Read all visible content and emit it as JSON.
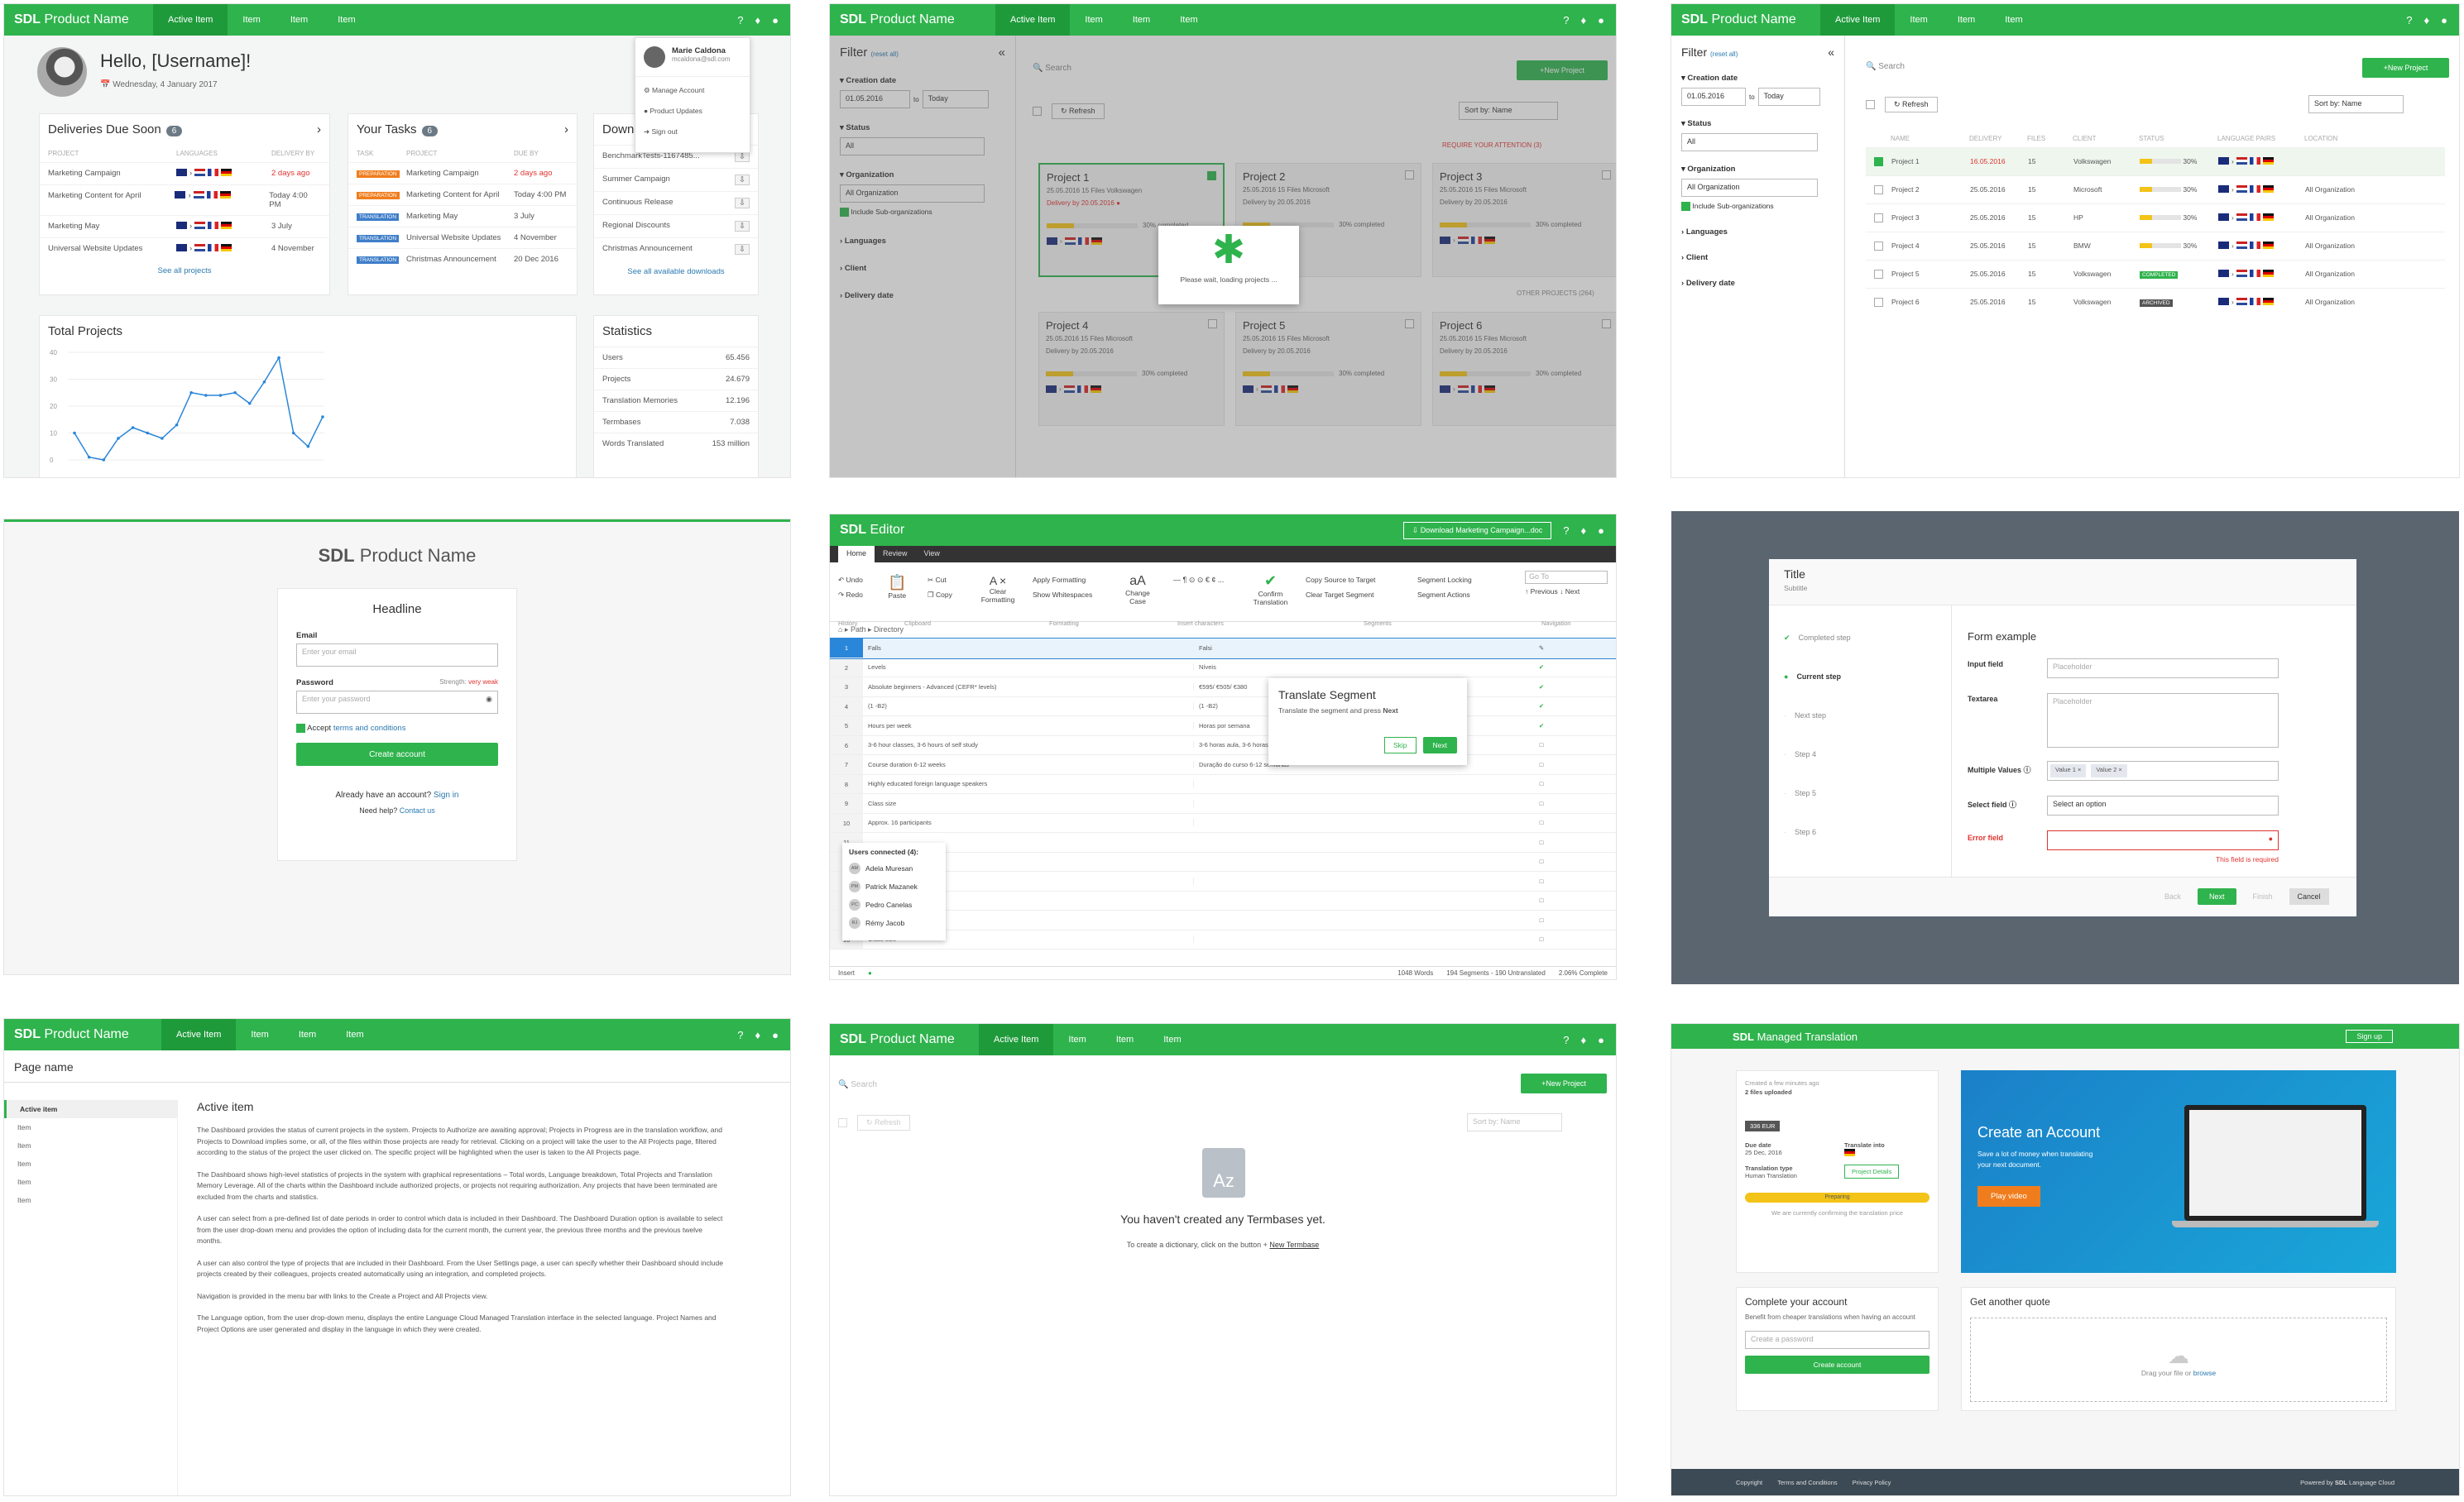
{
  "common": {
    "logo_brand": "SDL",
    "logo_product": "Product Name",
    "nav": [
      "Active Item",
      "Item",
      "Item",
      "Item"
    ],
    "icons": [
      "help-icon",
      "bell-icon",
      "user-icon"
    ]
  },
  "dashboard": {
    "greeting": "Hello, [Username]!",
    "date": "Wednesday, 4 January 2017",
    "user_menu": {
      "name": "Marie Caldona",
      "email": "mcaldona@sdl.com",
      "items": [
        "Manage Account",
        "Product Updates",
        "Sign out"
      ]
    },
    "deliveries": {
      "title": "Deliveries Due Soon",
      "count": "6",
      "cols": [
        "PROJECT",
        "LANGUAGES",
        "DELIVERY BY"
      ],
      "rows": [
        {
          "project": "Marketing Campaign",
          "due": "2 days ago",
          "late": true
        },
        {
          "project": "Marketing Content for April",
          "due": "Today 4:00 PM",
          "late": false
        },
        {
          "project": "Marketing May",
          "due": "3 July",
          "late": false
        },
        {
          "project": "Universal Website Updates",
          "due": "4 November",
          "late": false
        }
      ],
      "link": "See all projects"
    },
    "tasks": {
      "title": "Your Tasks",
      "count": "6",
      "cols": [
        "TASK",
        "PROJECT",
        "DUE BY"
      ],
      "rows": [
        {
          "tag": "PREPARATION",
          "project": "Marketing Campaign",
          "due": "2 days ago",
          "late": true
        },
        {
          "tag": "PREPARATION",
          "project": "Marketing Content for April",
          "due": "Today 4:00 PM",
          "late": false
        },
        {
          "tag": "TRANSLATION",
          "project": "Marketing May",
          "due": "3 July",
          "late": false
        },
        {
          "tag": "TRANSLATION",
          "project": "Universal Website Updates",
          "due": "4 November",
          "late": false
        },
        {
          "tag": "TRANSLATION",
          "project": "Christmas Announcement",
          "due": "20 Dec 2016",
          "late": false
        }
      ]
    },
    "downloads": {
      "title": "Downl",
      "rows": [
        "BenchmarkTests-1167485...",
        "Summer Campaign",
        "Continuous Release",
        "Regional Discounts",
        "Christmas Announcement"
      ],
      "link": "See all available downloads"
    },
    "total_projects": {
      "title": "Total Projects",
      "yticks": [
        "40",
        "30",
        "20",
        "10",
        "0"
      ]
    },
    "statistics": {
      "title": "Statistics",
      "rows": [
        {
          "label": "Users",
          "value": "65.456"
        },
        {
          "label": "Projects",
          "value": "24.679"
        },
        {
          "label": "Translation Memories",
          "value": "12.196"
        },
        {
          "label": "Termbases",
          "value": "7.038"
        },
        {
          "label": "Words Translated",
          "value": "153 million"
        }
      ]
    }
  },
  "chart_data": {
    "type": "line",
    "title": "Total Projects",
    "ylim": [
      0,
      40
    ],
    "values": [
      10,
      1,
      0,
      8,
      12,
      10,
      8,
      13,
      25,
      24,
      24,
      25,
      21,
      29,
      38,
      10,
      5,
      16
    ]
  },
  "filter_grid": {
    "filter_title": "Filter",
    "reset": "(reset all)",
    "creation_date": "Creation date",
    "date_from": "01.05.2016",
    "to": "to",
    "date_to": "Today",
    "status": "Status",
    "status_val": "All",
    "organization": "Organization",
    "org_val": "All Organization",
    "include_sub": "Include Sub-organizations",
    "languages": "Languages",
    "client": "Client",
    "delivery": "Delivery date",
    "search": "Search",
    "new_project": "New Project",
    "refresh": "Refresh",
    "sort": "Sort by: Name",
    "attention": "REQUIRE YOUR ATTENTION (3)",
    "other": "OTHER PROJECTS (264)",
    "loading": "Please wait, loading projects ...",
    "projects": [
      {
        "name": "Project 1",
        "meta": "25.05.2016    15 Files    Volkswagen",
        "delivery": "Delivery by 20.05.2016",
        "late": true,
        "pct": "30% completed"
      },
      {
        "name": "Project 2",
        "meta": "25.05.2016    15 Files    Microsoft",
        "delivery": "Delivery by 20.05.2016",
        "late": false,
        "pct": "30% completed"
      },
      {
        "name": "Project 3",
        "meta": "25.05.2016    15 Files    Microsoft",
        "delivery": "Delivery by 20.05.2016",
        "late": false,
        "pct": "30% completed"
      },
      {
        "name": "Project 4",
        "meta": "25.05.2016    15 Files    Microsoft",
        "delivery": "Delivery by 20.05.2016",
        "late": false,
        "pct": "30% completed"
      },
      {
        "name": "Project 5",
        "meta": "25.05.2016    15 Files    Microsoft",
        "delivery": "Delivery by 20.05.2016",
        "late": false,
        "pct": "30% completed"
      },
      {
        "name": "Project 6",
        "meta": "25.05.2016    15 Files    Microsoft",
        "delivery": "Delivery by 20.05.2016",
        "late": false,
        "pct": "30% completed"
      }
    ]
  },
  "filter_list": {
    "cols": [
      "NAME",
      "DELIVERY",
      "FILES",
      "CLIENT",
      "STATUS",
      "LANGUAGE PAIRS",
      "LOCATION"
    ],
    "rows": [
      {
        "name": "Project 1",
        "delivery": "16.05.2016",
        "files": "15",
        "client": "Volkswagen",
        "status": "30%",
        "loc": "",
        "late": true
      },
      {
        "name": "Project 2",
        "delivery": "25.05.2016",
        "files": "15",
        "client": "Microsoft",
        "status": "30%",
        "loc": "All Organization",
        "late": false
      },
      {
        "name": "Project 3",
        "delivery": "25.05.2016",
        "files": "15",
        "client": "HP",
        "status": "30%",
        "loc": "All Organization",
        "late": false
      },
      {
        "name": "Project 4",
        "delivery": "25.05.2016",
        "files": "15",
        "client": "BMW",
        "status": "30%",
        "loc": "All Organization",
        "late": false
      },
      {
        "name": "Project 5",
        "delivery": "25.05.2016",
        "files": "15",
        "client": "Volkswagen",
        "status": "COMPLETED",
        "loc": "All Organization",
        "late": false
      },
      {
        "name": "Project 6",
        "delivery": "25.05.2016",
        "files": "15",
        "client": "Volkswagen",
        "status": "ARCHIVED",
        "loc": "All Organization",
        "late": false
      }
    ]
  },
  "signup": {
    "brand": "SDL",
    "product": "Product Name",
    "headline": "Headline",
    "email": "Email",
    "email_ph": "Enter your email",
    "password": "Password",
    "strength": "Strength: very weak",
    "password_ph": "Enter your password",
    "accept": "Accept",
    "terms": "terms and conditions",
    "create": "Create account",
    "have_account": "Already have an account?",
    "signin": "Sign in",
    "need_help": "Need help?",
    "contact": "Contact us"
  },
  "editor": {
    "title_brand": "SDL",
    "title_app": "Editor",
    "download": "Download Marketing Campaign...doc",
    "tabs": [
      "Home",
      "Review",
      "View"
    ],
    "ribbon": {
      "undo": "Undo",
      "redo": "Redo",
      "history": "History",
      "paste": "Paste",
      "cut": "Cut",
      "copy": "Copy",
      "clipboard": "Clipboard",
      "clear": "Clear Formatting",
      "apply": "Apply Formatting",
      "show_ws": "Show Whitespaces",
      "change_case": "Change Case",
      "formatting": "Formatting",
      "insert_chars": "Insert characters",
      "confirm": "Confirm Translation",
      "copy_src": "Copy Source to Target",
      "clear_tgt": "Clear Target Segment",
      "seg_lock": "Segment Locking",
      "seg_actions": "Segment Actions",
      "segments": "Segments",
      "goto": "Go To",
      "previous": "Previous",
      "next": "Next",
      "navigation": "Navigation"
    },
    "breadcrumb": [
      "Path",
      "Directory"
    ],
    "rows": [
      {
        "n": "1",
        "src": "Falls",
        "tgt": "Falsi"
      },
      {
        "n": "2",
        "src": "Levels",
        "tgt": "Níveis"
      },
      {
        "n": "3",
        "src": "Absolute beginners - Advanced (CEFR* levels)",
        "tgt": "€595/ €505/ €380"
      },
      {
        "n": "4",
        "src": "(1 -B2)",
        "tgt": "(1 -B2)"
      },
      {
        "n": "5",
        "src": "Hours per week",
        "tgt": "Horas por semana"
      },
      {
        "n": "6",
        "src": "3-6 hour classes, 3-6 hours of self study",
        "tgt": "3-6 horas aula, 3-6 horas"
      },
      {
        "n": "7",
        "src": "Course duration 6-12 weeks",
        "tgt": "Duração do curso 6-12 semanas"
      },
      {
        "n": "8",
        "src": "Highly educated foreign language speakers",
        "tgt": ""
      },
      {
        "n": "9",
        "src": "Class size",
        "tgt": ""
      },
      {
        "n": "10",
        "src": "Approx. 16 participants",
        "tgt": ""
      },
      {
        "n": "11",
        "src": "",
        "tgt": ""
      },
      {
        "n": "12",
        "src": "",
        "tgt": ""
      },
      {
        "n": "13",
        "src": "vels",
        "tgt": ""
      },
      {
        "n": "14",
        "src": "",
        "tgt": ""
      },
      {
        "n": "15",
        "src": "",
        "tgt": ""
      },
      {
        "n": "16",
        "src": "Class size",
        "tgt": ""
      }
    ],
    "popover": {
      "title": "Translate Segment",
      "body": "Translate the segment and press",
      "body_bold": "Next",
      "skip": "Skip",
      "next": "Next"
    },
    "users": {
      "title": "Users connected (4):",
      "list": [
        {
          "init": "AM",
          "name": "Adela Muresan"
        },
        {
          "init": "PM",
          "name": "Patrick Mazanek"
        },
        {
          "init": "PC",
          "name": "Pedro Canelas"
        },
        {
          "init": "RJ",
          "name": "Rémy Jacob"
        }
      ]
    },
    "status": {
      "mode": "Insert",
      "words": "1048 Words",
      "segments": "194 Segments - 190 Untranslated",
      "complete": "2.06% Complete"
    }
  },
  "wizard": {
    "title": "Title",
    "subtitle": "Subtitle",
    "steps": [
      "Completed step",
      "Current step",
      "Next step",
      "Step 4",
      "Step 5",
      "Step 6"
    ],
    "form_title": "Form example",
    "input_label": "Input field",
    "textarea_label": "Textarea",
    "multi_label": "Multiple Values",
    "select_label": "Select field",
    "error_label": "Error field",
    "placeholder": "Placeholder",
    "multi_values": [
      "Value 1",
      "Value 2"
    ],
    "select_ph": "Select an option",
    "error_msg": "This field is required",
    "back": "Back",
    "next": "Next",
    "finish": "Finish",
    "cancel": "Cancel"
  },
  "docpage": {
    "page_name": "Page name",
    "sidebar": [
      "Active item",
      "Item",
      "Item",
      "Item",
      "Item",
      "Item"
    ],
    "heading": "Active item",
    "paragraphs": [
      "The Dashboard provides the status of current projects in the system. Projects to Authorize are awaiting approval; Projects in Progress are in the translation workflow, and Projects to Download implies some, or all, of the files within those projects are ready for retrieval. Clicking on a project will take the user to the All Projects page, filtered according to the status of the project the user clicked on. The specific project will be highlighted when the user is taken to the All Projects page.",
      "The Dashboard shows high-level statistics of projects in the system with graphical representations – Total words, Language breakdown, Total Projects and Translation Memory Leverage. All of the charts within the Dashboard include authorized projects, or projects not requiring authorization. Any projects that have been terminated are excluded from the charts and statistics.",
      "A user can select from a pre-defined list of date periods in order to control which data is included in their Dashboard. The Dashboard Duration option is available to select from the user drop-down menu and provides the option of including data for the current month, the current year, the previous three months and the previous twelve months.",
      "A user can also control the type of projects that are included in their Dashboard. From the User Settings page, a user can specify whether their Dashboard should include projects created by their colleagues, projects created automatically using an integration, and completed projects.",
      "Navigation is provided in the menu bar with links to the Create a Project and All Projects view.",
      "The Language option, from the user drop-down menu, displays the entire Language Cloud Managed Translation interface in the selected language. Project Names and Project Options are user generated and display in the language in which they were created."
    ]
  },
  "empty": {
    "search": "Search",
    "new_project": "New Project",
    "refresh": "Refresh",
    "sort": "Sort by: Name",
    "icon_text": "Az",
    "title": "You haven't created any Termbases yet.",
    "desc": "To create a dictionary, click on the button +",
    "link": "New Termbase"
  },
  "managed": {
    "brand": "SDL",
    "product": "Managed Translation",
    "signup": "Sign up",
    "status_card": {
      "created": "Created a few minutes ago",
      "files": "2 files uploaded",
      "price": "336 EUR",
      "due_label": "Due date",
      "due_val": "25 Dec, 2016",
      "into_label": "Translate into",
      "type_label": "Translation type",
      "type_val": "Human Translation",
      "details": "Project Details",
      "progress": "Preparing",
      "note": "We are currently confirming the translation price"
    },
    "hero": {
      "title": "Create an Account",
      "desc": "Save a lot of money when translating your next document.",
      "cta": "Play video"
    },
    "complete": {
      "title": "Complete your account",
      "desc": "Benefit from cheaper translations when having an account",
      "ph": "Create a password",
      "btn": "Create account"
    },
    "quote": {
      "title": "Get another quote",
      "drag": "Drag your file or",
      "browse": "browse"
    },
    "footer": {
      "links": [
        "Copyright",
        "Terms and Conditions",
        "Privacy Policy"
      ],
      "powered": "Powered by",
      "powered_brand": "SDL",
      "powered_product": "Language Cloud"
    }
  },
  "colors": {
    "brand_green": "#2fb34d",
    "dark_green": "#1f9a3b",
    "error_red": "#e0332f",
    "progress_yellow": "#f3c317"
  }
}
